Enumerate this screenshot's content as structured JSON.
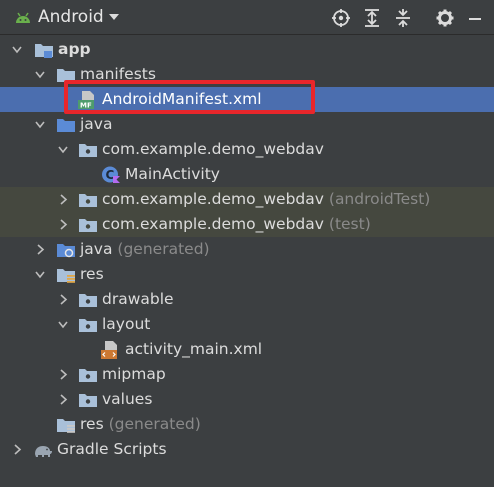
{
  "toolbar": {
    "view_label": "Android",
    "icons": [
      "android-icon",
      "chevron-down-icon",
      "locate-icon",
      "expand-all-icon",
      "collapse-all-icon",
      "gear-icon",
      "minimize-icon"
    ]
  },
  "tree": {
    "app": "app",
    "manifests": "manifests",
    "android_manifest": "AndroidManifest.xml",
    "java": "java",
    "pkg_main": "com.example.demo_webdav",
    "main_activity": "MainActivity",
    "pkg_android_test": "com.example.demo_webdav",
    "pkg_android_test_suffix": "(androidTest)",
    "pkg_test": "com.example.demo_webdav",
    "pkg_test_suffix": "(test)",
    "java_generated": "java",
    "java_generated_suffix": "(generated)",
    "res": "res",
    "drawable": "drawable",
    "layout": "layout",
    "activity_main": "activity_main.xml",
    "mipmap": "mipmap",
    "values": "values",
    "res_generated": "res",
    "res_generated_suffix": "(generated)",
    "gradle_scripts": "Gradle Scripts"
  },
  "colors": {
    "background": "#3c3f41",
    "selection": "#4b6eaf",
    "highlight_box": "#e8262b",
    "android_green": "#6ab04c",
    "folder_blue": "#a9c0d9"
  }
}
